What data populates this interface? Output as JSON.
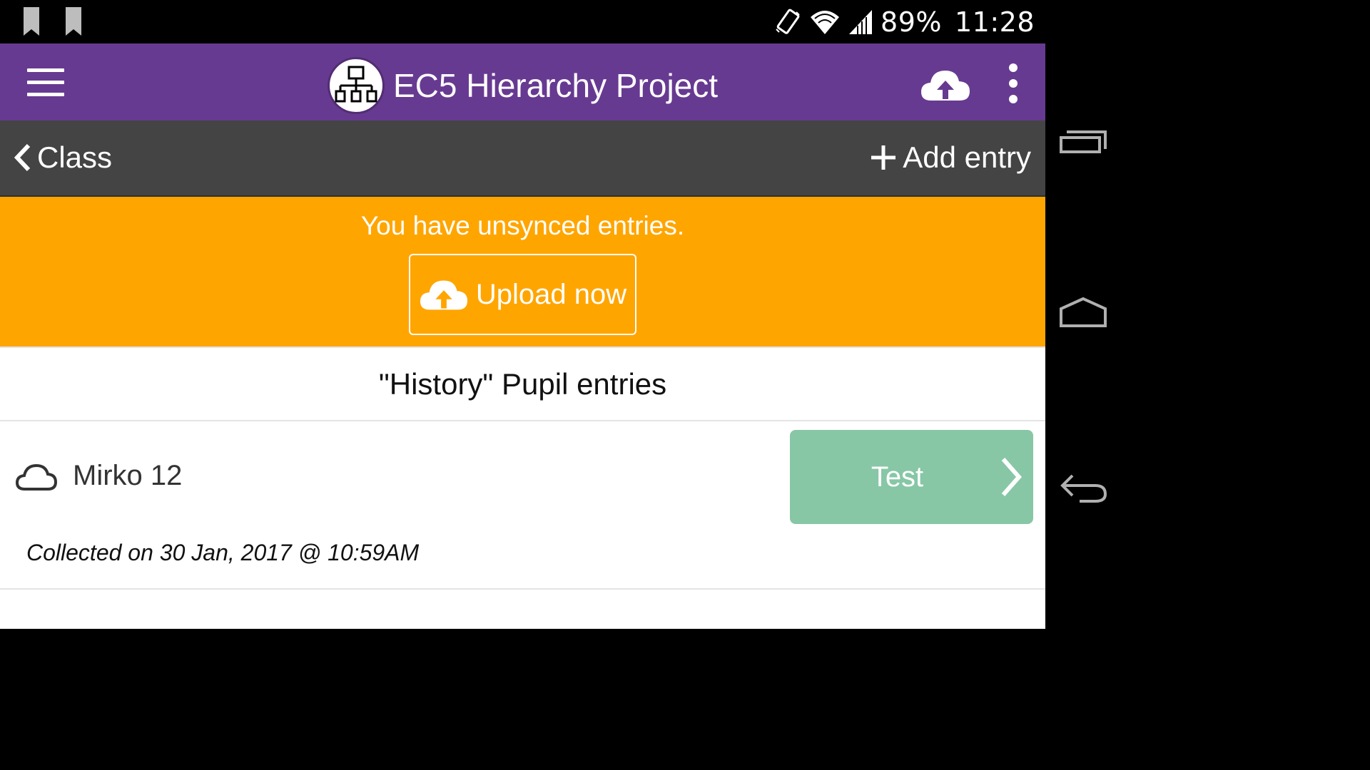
{
  "status_bar": {
    "battery": "89%",
    "time": "11:28",
    "icons": [
      "bookmark-icon",
      "bookmark-icon",
      "vibrate-icon",
      "wifi-icon",
      "signal-icon"
    ]
  },
  "app_bar": {
    "title": "EC5 Hierarchy Project",
    "menu_icon": "hamburger-icon",
    "logo_icon": "hierarchy-icon",
    "upload_icon": "cloud-upload-icon",
    "overflow_icon": "more-vert-icon"
  },
  "nav": {
    "back_label": "Class",
    "add_label": "Add entry"
  },
  "banner": {
    "message": "You have unsynced entries.",
    "button_label": "Upload now",
    "color": "#ffa500"
  },
  "list": {
    "heading": "\"History\" Pupil entries",
    "entries": [
      {
        "title": "Mirko 12",
        "collected": "Collected on 30 Jan, 2017 @ 10:59AM",
        "child_button": "Test",
        "sync_icon": "cloud-outline-icon"
      }
    ]
  },
  "system_nav": [
    "recents-icon",
    "home-icon",
    "back-icon"
  ],
  "colors": {
    "app_bar": "#673a91",
    "sub_bar": "#444444",
    "child_button": "#87c7a6"
  }
}
